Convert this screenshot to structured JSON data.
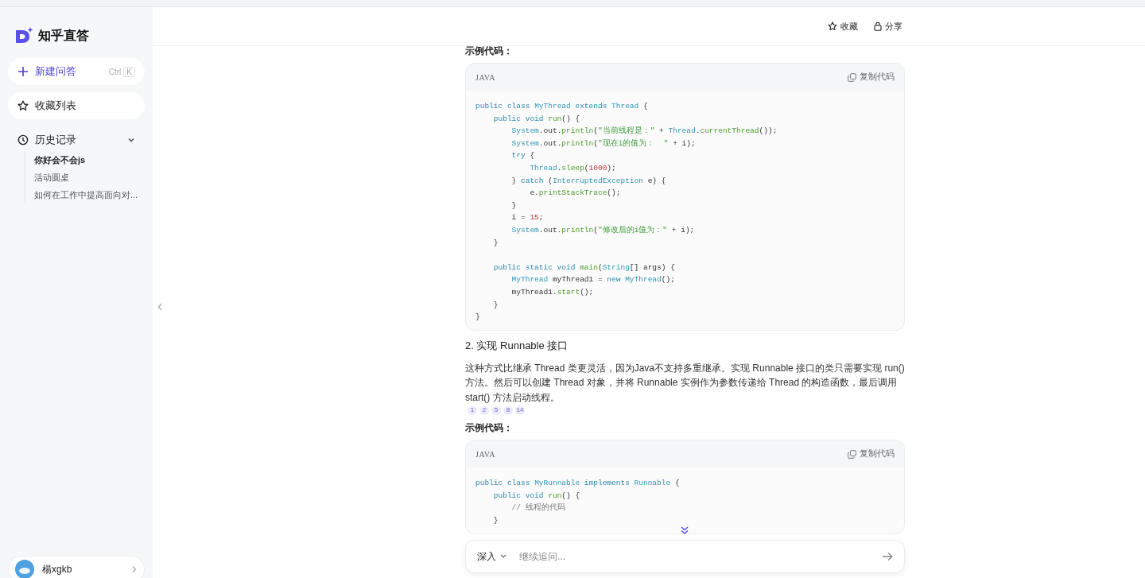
{
  "sidebar": {
    "logo": "知乎直答",
    "new_question": {
      "label": "新建问答",
      "shortcut_modifier": "Ctrl",
      "shortcut_key": "K"
    },
    "favorites": "收藏列表",
    "history": {
      "label": "历史记录",
      "expanded": true,
      "items": [
        {
          "label": "你好会不会js",
          "selected": true
        },
        {
          "label": "活动圆桌",
          "selected": false
        },
        {
          "label": "如何在工作中提高面向对...",
          "selected": false
        }
      ]
    },
    "user": {
      "name": "楊xgkb"
    }
  },
  "header": {
    "actions": [
      "收藏",
      "分享"
    ]
  },
  "answer": {
    "blocks": [
      {
        "kind": "caption",
        "text": "示例代码："
      },
      {
        "kind": "code",
        "language": "JAVA",
        "copy_label": "复制代码",
        "lines": [
          {
            "tokens": [
              {
                "kind": "keyword",
                "text": "public class "
              },
              {
                "kind": "type",
                "text": "MyThread "
              },
              {
                "kind": "keyword",
                "text": "extends "
              },
              {
                "kind": "type",
                "text": "Thread "
              },
              {
                "kind": "plain",
                "text": "{"
              }
            ]
          },
          {
            "tokens": [
              {
                "kind": "keyword",
                "text": "    public void "
              },
              {
                "kind": "function",
                "text": "run"
              },
              {
                "kind": "plain",
                "text": "() {"
              }
            ]
          },
          {
            "tokens": [
              {
                "kind": "type",
                "text": "        System"
              },
              {
                "kind": "plain",
                "text": ".out."
              },
              {
                "kind": "function",
                "text": "println"
              },
              {
                "kind": "plain",
                "text": "("
              },
              {
                "kind": "string",
                "text": "\"当前线程是：\""
              },
              {
                "kind": "plain",
                "text": " + "
              },
              {
                "kind": "type",
                "text": "Thread"
              },
              {
                "kind": "plain",
                "text": "."
              },
              {
                "kind": "function",
                "text": "currentThread"
              },
              {
                "kind": "plain",
                "text": "());"
              }
            ]
          },
          {
            "tokens": [
              {
                "kind": "type",
                "text": "        System"
              },
              {
                "kind": "plain",
                "text": ".out."
              },
              {
                "kind": "function",
                "text": "println"
              },
              {
                "kind": "plain",
                "text": "("
              },
              {
                "kind": "string",
                "text": "\"现在i的值为：  \""
              },
              {
                "kind": "plain",
                "text": " + i);"
              }
            ]
          },
          {
            "tokens": [
              {
                "kind": "keyword",
                "text": "        try "
              },
              {
                "kind": "plain",
                "text": "{"
              }
            ]
          },
          {
            "tokens": [
              {
                "kind": "type",
                "text": "            Thread"
              },
              {
                "kind": "plain",
                "text": "."
              },
              {
                "kind": "function",
                "text": "sleep"
              },
              {
                "kind": "plain",
                "text": "("
              },
              {
                "kind": "number",
                "text": "1000"
              },
              {
                "kind": "plain",
                "text": ");"
              }
            ]
          },
          {
            "tokens": [
              {
                "kind": "plain",
                "text": "        } "
              },
              {
                "kind": "keyword",
                "text": "catch "
              },
              {
                "kind": "plain",
                "text": "("
              },
              {
                "kind": "type",
                "text": "InterruptedException "
              },
              {
                "kind": "plain",
                "text": "e) {"
              }
            ]
          },
          {
            "tokens": [
              {
                "kind": "plain",
                "text": "            e."
              },
              {
                "kind": "function",
                "text": "printStackTrace"
              },
              {
                "kind": "plain",
                "text": "();"
              }
            ]
          },
          {
            "tokens": [
              {
                "kind": "plain",
                "text": "        }"
              }
            ]
          },
          {
            "tokens": [
              {
                "kind": "plain",
                "text": "        i = "
              },
              {
                "kind": "number",
                "text": "15"
              },
              {
                "kind": "plain",
                "text": ";"
              }
            ]
          },
          {
            "tokens": [
              {
                "kind": "type",
                "text": "        System"
              },
              {
                "kind": "plain",
                "text": ".out."
              },
              {
                "kind": "function",
                "text": "println"
              },
              {
                "kind": "plain",
                "text": "("
              },
              {
                "kind": "string",
                "text": "\"修改后的i值为：\""
              },
              {
                "kind": "plain",
                "text": " + i);"
              }
            ]
          },
          {
            "tokens": [
              {
                "kind": "plain",
                "text": "    }"
              }
            ]
          },
          {
            "kind": "blank"
          },
          {
            "tokens": [
              {
                "kind": "keyword",
                "text": "    public static void "
              },
              {
                "kind": "function",
                "text": "main"
              },
              {
                "kind": "plain",
                "text": "("
              },
              {
                "kind": "type",
                "text": "String"
              },
              {
                "kind": "plain",
                "text": "[] args) {"
              }
            ]
          },
          {
            "tokens": [
              {
                "kind": "type",
                "text": "        MyThread "
              },
              {
                "kind": "plain",
                "text": "myThread1 = "
              },
              {
                "kind": "keyword",
                "text": "new "
              },
              {
                "kind": "type",
                "text": "MyThread"
              },
              {
                "kind": "plain",
                "text": "();"
              }
            ]
          },
          {
            "tokens": [
              {
                "kind": "plain",
                "text": "        myThread1."
              },
              {
                "kind": "function",
                "text": "start"
              },
              {
                "kind": "plain",
                "text": "();"
              }
            ]
          },
          {
            "tokens": [
              {
                "kind": "plain",
                "text": "    }"
              }
            ]
          },
          {
            "tokens": [
              {
                "kind": "plain",
                "text": "}"
              }
            ]
          }
        ]
      },
      {
        "kind": "heading",
        "text": "2. 实现 Runnable 接口"
      },
      {
        "kind": "paragraph",
        "text": "这种方式比继承 Thread 类更灵活，因为Java不支持多重继承。实现 Runnable 接口的类只需要实现 run() 方法。然后可以创建 Thread 对象，并将 Runnable 实例作为参数传递给 Thread 的构造函数，最后调用 start() 方法启动线程。",
        "citations": [
          "1",
          "2",
          "5",
          "8",
          "14"
        ]
      },
      {
        "kind": "caption",
        "text": "示例代码："
      },
      {
        "kind": "code",
        "language": "JAVA",
        "copy_label": "复制代码",
        "lines": [
          {
            "tokens": [
              {
                "kind": "keyword",
                "text": "public class "
              },
              {
                "kind": "type",
                "text": "MyRunnable "
              },
              {
                "kind": "keyword",
                "text": "implements "
              },
              {
                "kind": "type",
                "text": "Runnable "
              },
              {
                "kind": "plain",
                "text": "{"
              }
            ]
          },
          {
            "tokens": [
              {
                "kind": "keyword",
                "text": "    public void "
              },
              {
                "kind": "function",
                "text": "run"
              },
              {
                "kind": "plain",
                "text": "() {"
              }
            ]
          },
          {
            "tokens": [
              {
                "kind": "comment",
                "text": "        // 线程的代码"
              }
            ]
          },
          {
            "tokens": [
              {
                "kind": "plain",
                "text": "    }"
              }
            ]
          }
        ]
      }
    ]
  },
  "composer": {
    "mode": "深入",
    "placeholder": "继续追问..."
  }
}
